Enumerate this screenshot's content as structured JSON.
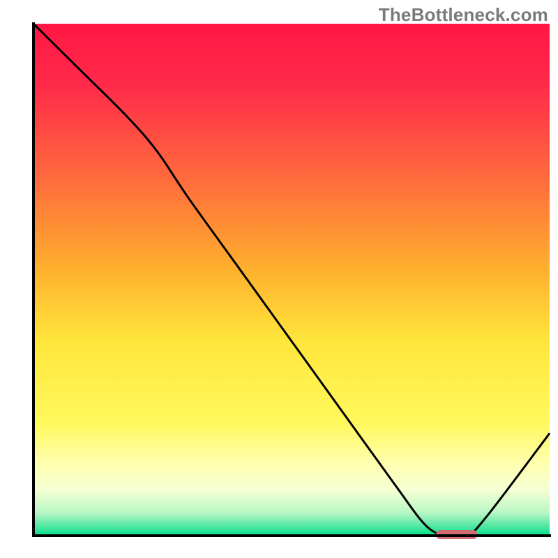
{
  "attribution": "TheBottleneck.com",
  "colors": {
    "axis": "#000000",
    "curve": "#000000",
    "marker_fill": "#d36b72",
    "gradient_stops": [
      {
        "offset": 0.0,
        "color": "#ff1744"
      },
      {
        "offset": 0.12,
        "color": "#ff2a4a"
      },
      {
        "offset": 0.3,
        "color": "#ff6a3d"
      },
      {
        "offset": 0.48,
        "color": "#ffb02e"
      },
      {
        "offset": 0.62,
        "color": "#ffe63b"
      },
      {
        "offset": 0.78,
        "color": "#fff95d"
      },
      {
        "offset": 0.86,
        "color": "#ffffb0"
      },
      {
        "offset": 0.91,
        "color": "#f6ffd4"
      },
      {
        "offset": 0.955,
        "color": "#b8f7c4"
      },
      {
        "offset": 0.978,
        "color": "#5fe9a7"
      },
      {
        "offset": 1.0,
        "color": "#00e08a"
      }
    ]
  },
  "chart_data": {
    "type": "line",
    "title": "",
    "xlabel": "",
    "ylabel": "",
    "xlim": [
      0,
      100
    ],
    "ylim": [
      0,
      100
    ],
    "x": [
      0,
      8,
      18,
      24,
      30,
      40,
      50,
      60,
      70,
      76,
      80,
      84,
      88,
      100
    ],
    "values": [
      100,
      92,
      82,
      75,
      66,
      52,
      38,
      24,
      10,
      2,
      0,
      0,
      4,
      20
    ],
    "series": [
      {
        "name": "bottleneck-curve",
        "x": [
          0,
          8,
          18,
          24,
          30,
          40,
          50,
          60,
          70,
          76,
          80,
          84,
          88,
          100
        ],
        "values": [
          100,
          92,
          82,
          75,
          66,
          52,
          38,
          24,
          10,
          2,
          0,
          0,
          4,
          20
        ]
      }
    ],
    "optimal_marker": {
      "x_start": 78,
      "x_end": 86,
      "y": 0
    }
  }
}
